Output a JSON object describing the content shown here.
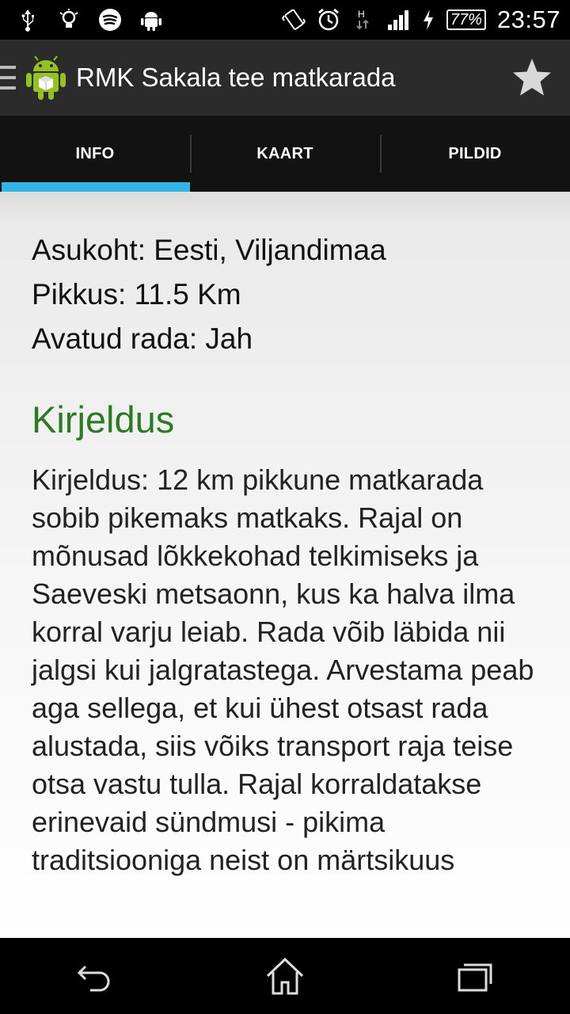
{
  "status_bar": {
    "left_icons": [
      "usb-icon",
      "lightbulb-icon",
      "spotify-icon",
      "android-debug-icon"
    ],
    "right_icons": [
      "vibrate-icon",
      "alarm-icon",
      "h-data-icon",
      "signal-icon",
      "charging-icon"
    ],
    "battery": "77%",
    "time": "23:57"
  },
  "action_bar": {
    "title": "RMK Sakala tee matkarada",
    "icons": [
      "menu-icon",
      "app-logo-icon",
      "star-icon"
    ]
  },
  "tabs": [
    {
      "label": "INFO",
      "active": true
    },
    {
      "label": "KAART",
      "active": false
    },
    {
      "label": "PILDID",
      "active": false
    }
  ],
  "content": {
    "location": "Asukoht: Eesti, Viljandimaa",
    "length": "Pikkus: 11.5 Km",
    "open_trail": "Avatud rada: Jah",
    "section_title": "Kirjeldus",
    "description": "Kirjeldus: 12 km pikkune matkarada sobib pikemaks matkaks. Rajal on mõnusad lõkkekohad telkimiseks ja Saeveski metsaonn, kus ka halva ilma korral varju leiab. Rada võib läbida nii jalgsi kui jalgratastega. Arvestama peab aga sellega, et kui ühest otsast rada alustada, siis võiks transport raja teise otsa vastu tulla. Rajal korraldatakse erinevaid sündmusi - pikima traditsiooniga neist on märtsikuus"
  },
  "nav_bar": {
    "icons": [
      "back-icon",
      "home-icon",
      "recents-icon"
    ]
  },
  "colors": {
    "accent_tab": "#33b5e5",
    "section_title": "#2d7a25",
    "action_bar": "#2b2b2b"
  }
}
